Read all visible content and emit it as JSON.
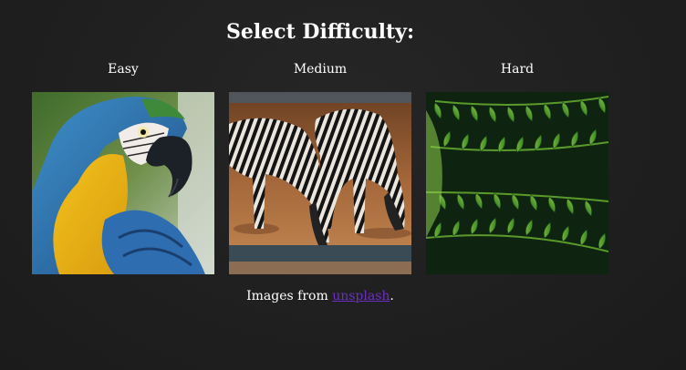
{
  "heading": "Select Difficulty:",
  "options": [
    {
      "label": "Easy",
      "image": "macaw-parrot"
    },
    {
      "label": "Medium",
      "image": "zebras-drinking"
    },
    {
      "label": "Hard",
      "image": "green-fern-leaves"
    }
  ],
  "credit": {
    "prefix": "Images from ",
    "link_text": "unsplash",
    "suffix": "."
  },
  "colors": {
    "background": "#1f1f1f",
    "text": "#ffffff",
    "link": "#6a2fc0"
  }
}
